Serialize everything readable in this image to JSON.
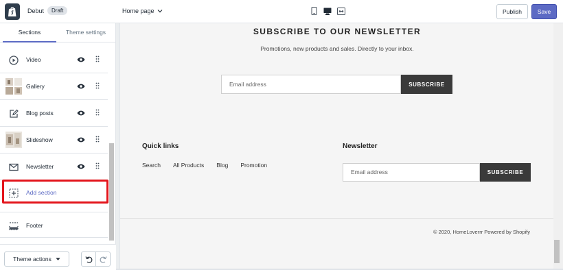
{
  "header": {
    "theme_name": "Debut",
    "badge": "Draft",
    "page_selector": "Home page",
    "publish_label": "Publish",
    "save_label": "Save"
  },
  "sidebar": {
    "tabs": [
      {
        "label": "Sections",
        "active": true
      },
      {
        "label": "Theme settings",
        "active": false
      }
    ],
    "sections": [
      {
        "label": "Video",
        "icon": "play-circle-icon"
      },
      {
        "label": "Gallery",
        "icon": "gallery-thumbnail"
      },
      {
        "label": "Blog posts",
        "icon": "edit-icon"
      },
      {
        "label": "Slideshow",
        "icon": "slideshow-thumbnail"
      },
      {
        "label": "Newsletter",
        "icon": "mail-icon"
      }
    ],
    "add_section": "Add section",
    "footer": "Footer",
    "theme_actions": "Theme actions"
  },
  "preview": {
    "newsletter_title": "SUBSCRIBE TO OUR NEWSLETTER",
    "newsletter_subtitle": "Promotions, new products and sales. Directly to your inbox.",
    "email_placeholder": "Email address",
    "subscribe_label": "SUBSCRIBE",
    "quick_links_title": "Quick links",
    "quick_links": [
      "Search",
      "All Products",
      "Blog",
      "Promotion"
    ],
    "footer_newsletter_title": "Newsletter",
    "footer_email_placeholder": "Email address",
    "footer_subscribe_label": "SUBSCRIBE",
    "copyright": "© 2020, HomeLoverrr Powered by Shopify"
  },
  "colors": {
    "accent": "#5c6ac4",
    "highlight": "#e3141b",
    "button_dark": "#3a3a3a"
  }
}
